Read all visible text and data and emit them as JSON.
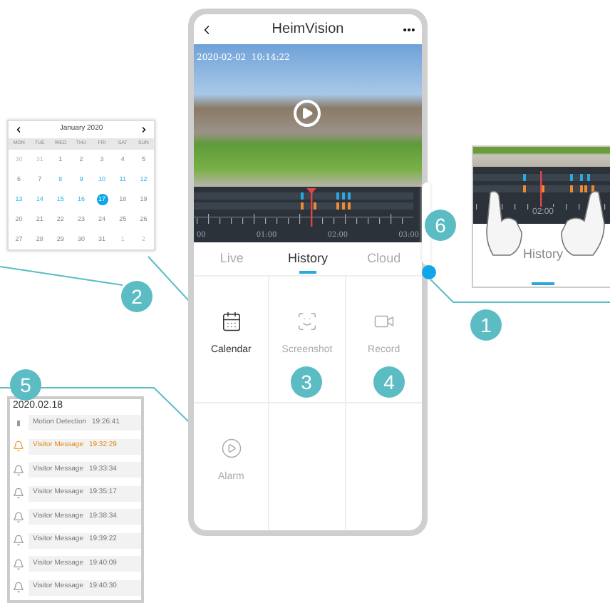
{
  "calendar": {
    "month": "January 2020",
    "weekdays": [
      "MON",
      "TUE",
      "WED",
      "THU",
      "FRI",
      "SAT",
      "SUN"
    ],
    "weeks": [
      [
        {
          "label": "30",
          "kind": "outside",
          "selected": false
        },
        {
          "label": "31",
          "kind": "outside",
          "selected": false
        },
        {
          "label": "1",
          "kind": "plain",
          "selected": false
        },
        {
          "label": "2",
          "kind": "plain",
          "selected": false
        },
        {
          "label": "3",
          "kind": "plain",
          "selected": false
        },
        {
          "label": "4",
          "kind": "plain",
          "selected": false
        },
        {
          "label": "5",
          "kind": "plain",
          "selected": false
        }
      ],
      [
        {
          "label": "6",
          "kind": "plain",
          "selected": false
        },
        {
          "label": "7",
          "kind": "plain",
          "selected": false
        },
        {
          "label": "8",
          "kind": "recorded",
          "selected": false
        },
        {
          "label": "9",
          "kind": "recorded",
          "selected": false
        },
        {
          "label": "10",
          "kind": "recorded",
          "selected": false
        },
        {
          "label": "11",
          "kind": "recorded",
          "selected": false
        },
        {
          "label": "12",
          "kind": "recorded",
          "selected": false
        }
      ],
      [
        {
          "label": "13",
          "kind": "recorded",
          "selected": false
        },
        {
          "label": "14",
          "kind": "recorded",
          "selected": false
        },
        {
          "label": "15",
          "kind": "recorded",
          "selected": false
        },
        {
          "label": "16",
          "kind": "recorded",
          "selected": false
        },
        {
          "label": "17",
          "kind": "recorded",
          "selected": true
        },
        {
          "label": "18",
          "kind": "plain",
          "selected": false
        },
        {
          "label": "19",
          "kind": "plain",
          "selected": false
        }
      ],
      [
        {
          "label": "20",
          "kind": "plain",
          "selected": false
        },
        {
          "label": "21",
          "kind": "plain",
          "selected": false
        },
        {
          "label": "22",
          "kind": "plain",
          "selected": false
        },
        {
          "label": "23",
          "kind": "plain",
          "selected": false
        },
        {
          "label": "24",
          "kind": "plain",
          "selected": false
        },
        {
          "label": "25",
          "kind": "plain",
          "selected": false
        },
        {
          "label": "26",
          "kind": "plain",
          "selected": false
        }
      ],
      [
        {
          "label": "27",
          "kind": "plain",
          "selected": false
        },
        {
          "label": "28",
          "kind": "plain",
          "selected": false
        },
        {
          "label": "29",
          "kind": "plain",
          "selected": false
        },
        {
          "label": "30",
          "kind": "plain",
          "selected": false
        },
        {
          "label": "31",
          "kind": "plain",
          "selected": false
        },
        {
          "label": "1",
          "kind": "outside",
          "selected": false
        },
        {
          "label": "2",
          "kind": "outside",
          "selected": false
        }
      ]
    ]
  },
  "phone": {
    "title": "HeimVision",
    "timestamp": "2020-02-02  10:14:22",
    "timeline_labels": [
      "00",
      "01:00",
      "02:00",
      "03:00"
    ],
    "tabs": [
      {
        "label": "Live",
        "selected": false
      },
      {
        "label": "History",
        "selected": true
      },
      {
        "label": "Cloud",
        "selected": false
      }
    ],
    "functions": [
      {
        "label": "Calendar",
        "kind": "calendar",
        "enabled": true
      },
      {
        "label": "Screenshot",
        "kind": "screenshot",
        "enabled": false
      },
      {
        "label": "Record",
        "kind": "record",
        "enabled": false
      },
      {
        "label": "Alarm",
        "kind": "alarm",
        "enabled": false
      }
    ]
  },
  "alarm_list": {
    "date": "2020.02.18",
    "events": [
      {
        "label": "Motion Detection",
        "time": "19:26:41",
        "kind": "motion",
        "selected": false
      },
      {
        "label": "Visitor Message",
        "time": "19:32:29",
        "kind": "visitor",
        "selected": true
      },
      {
        "label": "Visitor Message",
        "time": "19:33:34",
        "kind": "visitor",
        "selected": false
      },
      {
        "label": "Visitor Message",
        "time": "19:35:17",
        "kind": "visitor",
        "selected": false
      },
      {
        "label": "Visitor Message",
        "time": "19:38:34",
        "kind": "visitor",
        "selected": false
      },
      {
        "label": "Visitor Message",
        "time": "19:39:22",
        "kind": "visitor",
        "selected": false
      },
      {
        "label": "Visitor Message",
        "time": "19:40:09",
        "kind": "visitor",
        "selected": false
      },
      {
        "label": "Visitor Message",
        "time": "19:40:30",
        "kind": "visitor",
        "selected": false
      }
    ]
  },
  "inset": {
    "tab_label": "History",
    "time_label": "02:00"
  },
  "callouts": [
    "6",
    "2",
    "1",
    "5",
    "3",
    "4"
  ]
}
